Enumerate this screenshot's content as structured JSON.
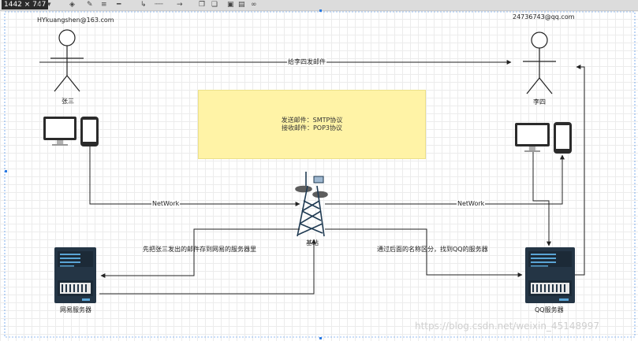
{
  "toolbar": {
    "dimensions": "1442 × 747",
    "icons": [
      "text-icon",
      "fill-icon",
      "line-color-icon",
      "line-style-icon",
      "connector-icon",
      "waypoints-icon",
      "arrow-icon",
      "to-front-icon",
      "to-back-icon",
      "lock-icon",
      "group-icon",
      "link-icon"
    ]
  },
  "diagram": {
    "left_person": {
      "email": "HYkuangshen@163.com",
      "name": "张三"
    },
    "right_person": {
      "email": "24736743@qq.com",
      "name": "李四"
    },
    "send_email_label": "给李四发邮件",
    "note": {
      "line1": "发送邮件：SMTP协议",
      "line2": "接收邮件：POP3协议"
    },
    "network_left": "NetWork",
    "network_right": "NetWork",
    "tower_label": "基站",
    "left_path_label": "先把张三发出的邮件存到网易的服务器里",
    "right_path_label": "通过后面的名称区分，找到QQ的服务器",
    "left_server_label": "网易服务器",
    "right_server_label": "QQ服务器",
    "colors": {
      "note_fill": "#fff3a6",
      "server_body": "#243545",
      "server_accent": "#5aa5d6",
      "tower": "#1f3a52",
      "line": "#222222"
    }
  },
  "watermark": "https://blog.csdn.net/weixin_45148997"
}
